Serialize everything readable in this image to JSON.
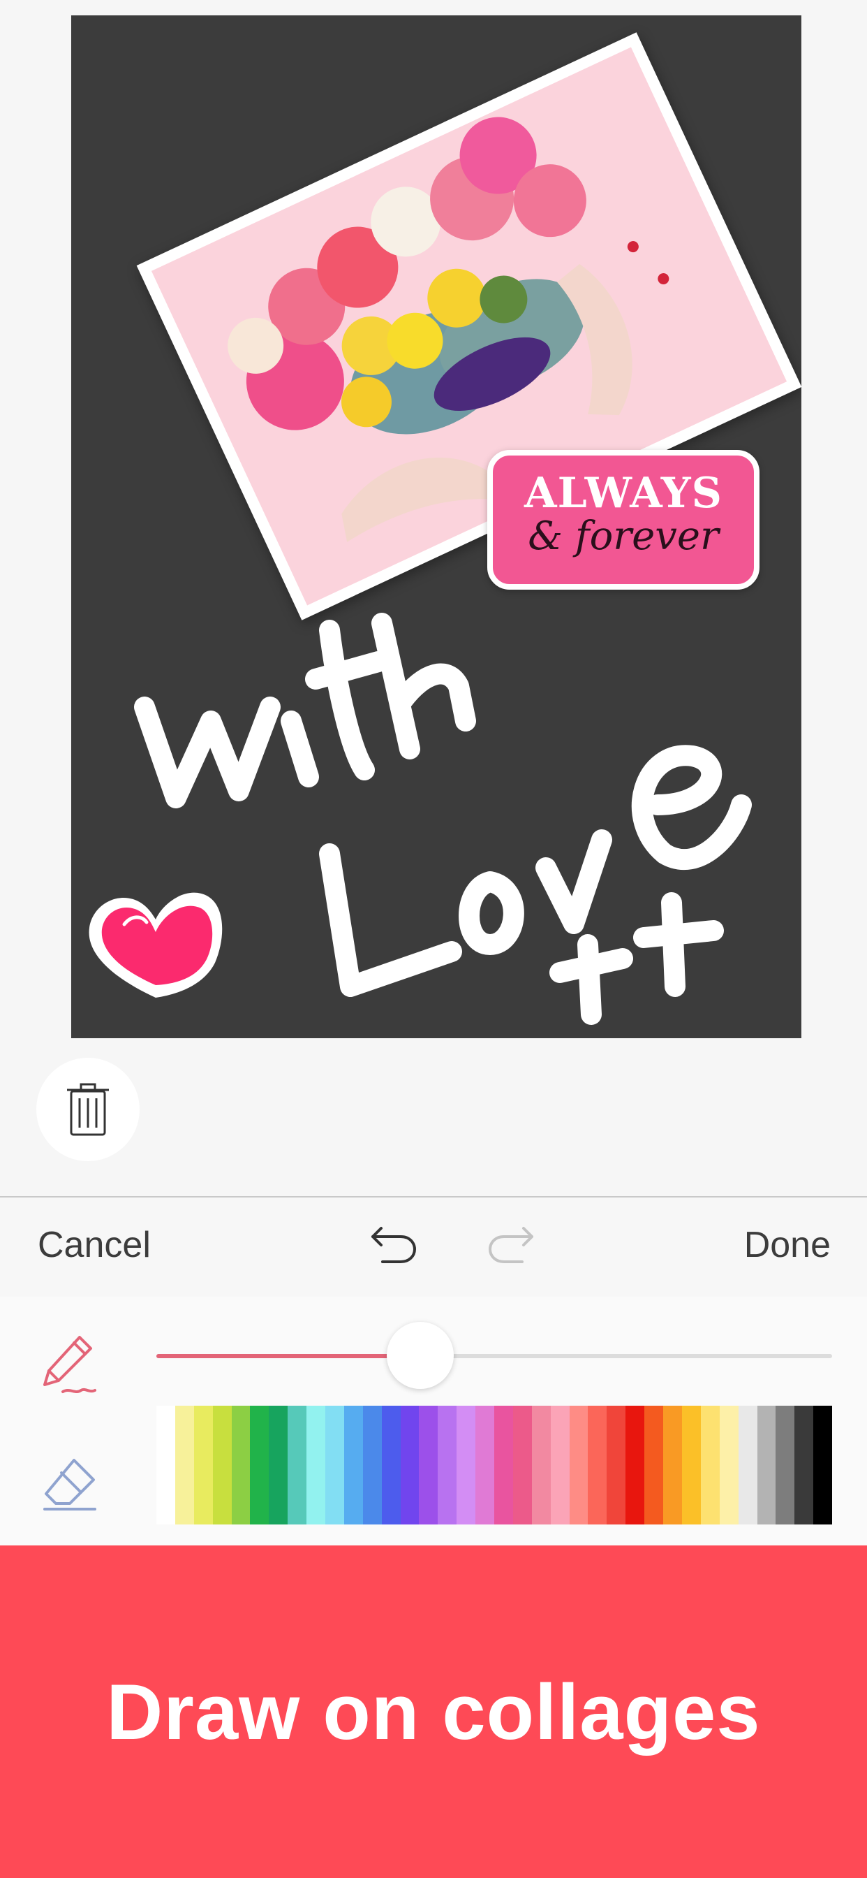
{
  "canvas": {
    "sticker": {
      "line1": "ALWAYS",
      "line2": "& forever"
    },
    "drawn_text": {
      "line1": "With",
      "line2": "Love",
      "line3": "xx"
    }
  },
  "toolbar": {
    "cancel_label": "Cancel",
    "done_label": "Done"
  },
  "tools": {
    "brush_size_fraction": 0.39,
    "palette_colors": [
      "#ffffff",
      "#f7f19a",
      "#e8eb5f",
      "#c8df3e",
      "#8ccf44",
      "#21b34a",
      "#17a45e",
      "#56c9b9",
      "#92f2ef",
      "#82def3",
      "#56acf0",
      "#4b89ea",
      "#4d5ced",
      "#7145ee",
      "#9c50ea",
      "#b872f0",
      "#d38df4",
      "#e07ad5",
      "#e9549f",
      "#ec5a8a",
      "#f289a1",
      "#fba4b7",
      "#fe8c85",
      "#fb6659",
      "#f0453a",
      "#e8160e",
      "#f45a1f",
      "#f99a24",
      "#fbc028",
      "#fde170",
      "#fdf0a8",
      "#e8e8e8",
      "#b3b3b3",
      "#7d7d7d",
      "#3a3a3a",
      "#000000"
    ]
  },
  "banner": {
    "text": "Draw on collages"
  },
  "colors": {
    "banner_bg": "#fe4a56",
    "canvas_bg": "#3c3c3c",
    "accent": "#e36477"
  }
}
